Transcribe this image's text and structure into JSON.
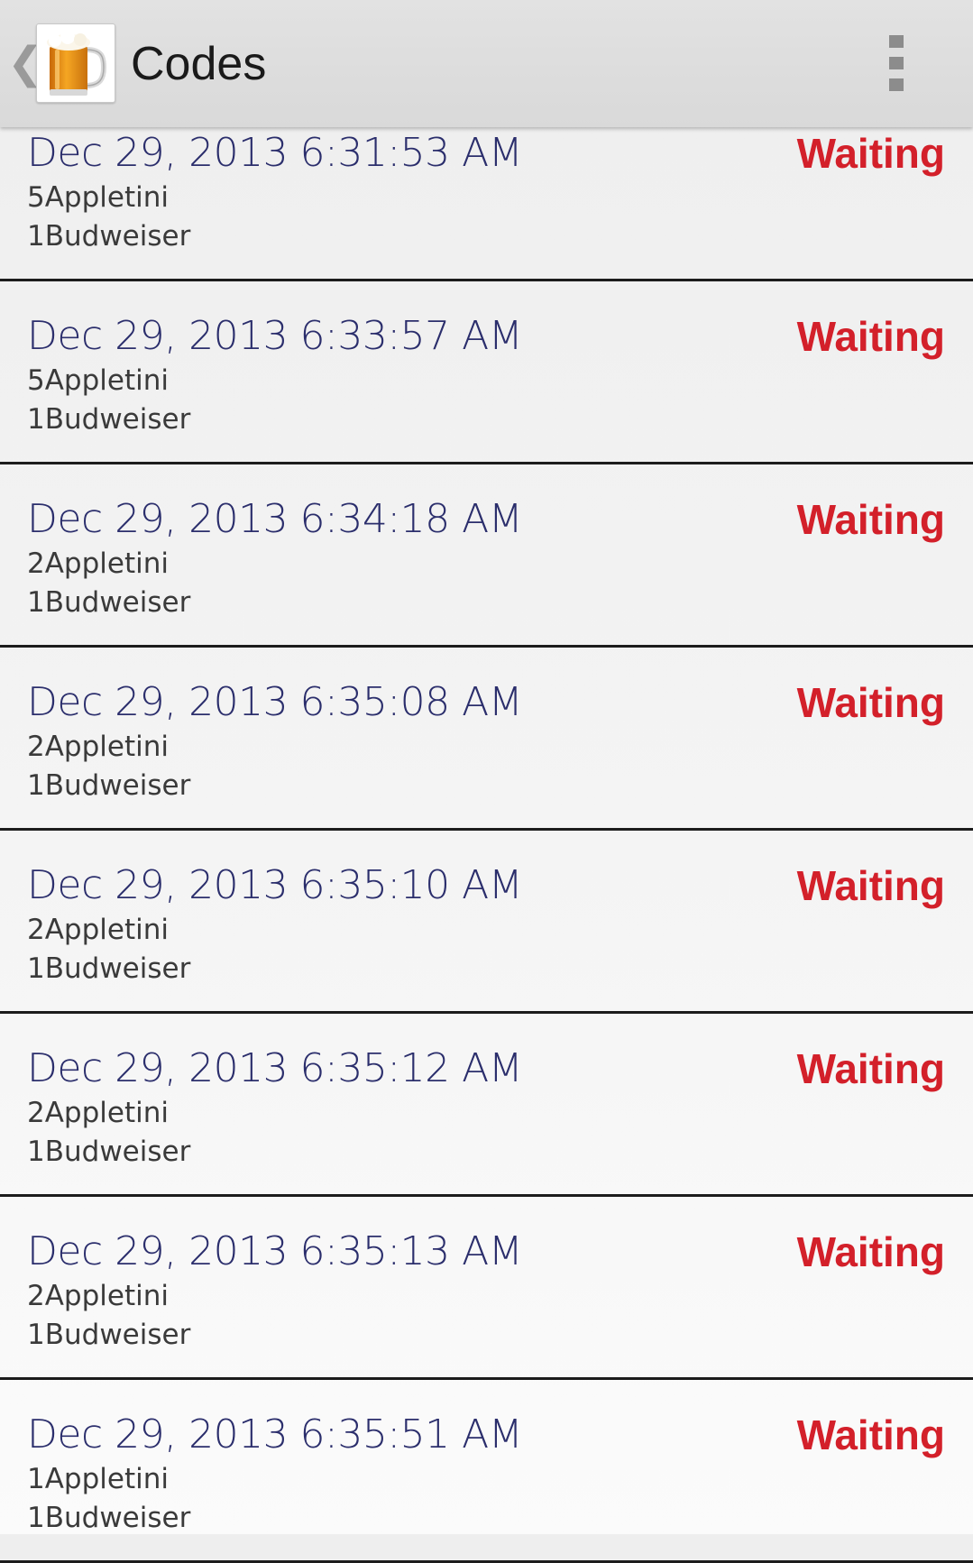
{
  "action_bar": {
    "back_glyph": "❮",
    "app_icon": "beer-mug-icon",
    "title": "Codes",
    "overflow_icon": "overflow-menu-icon"
  },
  "orders": [
    {
      "date": "Dec 29, 2013 6:31:53 AM",
      "status": "Waiting",
      "items": [
        "5Appletini",
        "1Budweiser"
      ]
    },
    {
      "date": "Dec 29, 2013 6:33:57 AM",
      "status": "Waiting",
      "items": [
        "5Appletini",
        "1Budweiser"
      ]
    },
    {
      "date": "Dec 29, 2013 6:34:18 AM",
      "status": "Waiting",
      "items": [
        "2Appletini",
        "1Budweiser"
      ]
    },
    {
      "date": "Dec 29, 2013 6:35:08 AM",
      "status": "Waiting",
      "items": [
        "2Appletini",
        "1Budweiser"
      ]
    },
    {
      "date": "Dec 29, 2013 6:35:10 AM",
      "status": "Waiting",
      "items": [
        "2Appletini",
        "1Budweiser"
      ]
    },
    {
      "date": "Dec 29, 2013 6:35:12 AM",
      "status": "Waiting",
      "items": [
        "2Appletini",
        "1Budweiser"
      ]
    },
    {
      "date": "Dec 29, 2013 6:35:13 AM",
      "status": "Waiting",
      "items": [
        "2Appletini",
        "1Budweiser"
      ]
    },
    {
      "date": "Dec 29, 2013 6:35:51 AM",
      "status": "Waiting",
      "items": [
        "1Appletini",
        "1Budweiser"
      ]
    }
  ],
  "colors": {
    "date_text": "#2b2e6c",
    "status_waiting": "#d3202a",
    "item_text": "#3a3a3a",
    "divider": "#1c1c1c",
    "action_bar": "#dcdcdc"
  }
}
